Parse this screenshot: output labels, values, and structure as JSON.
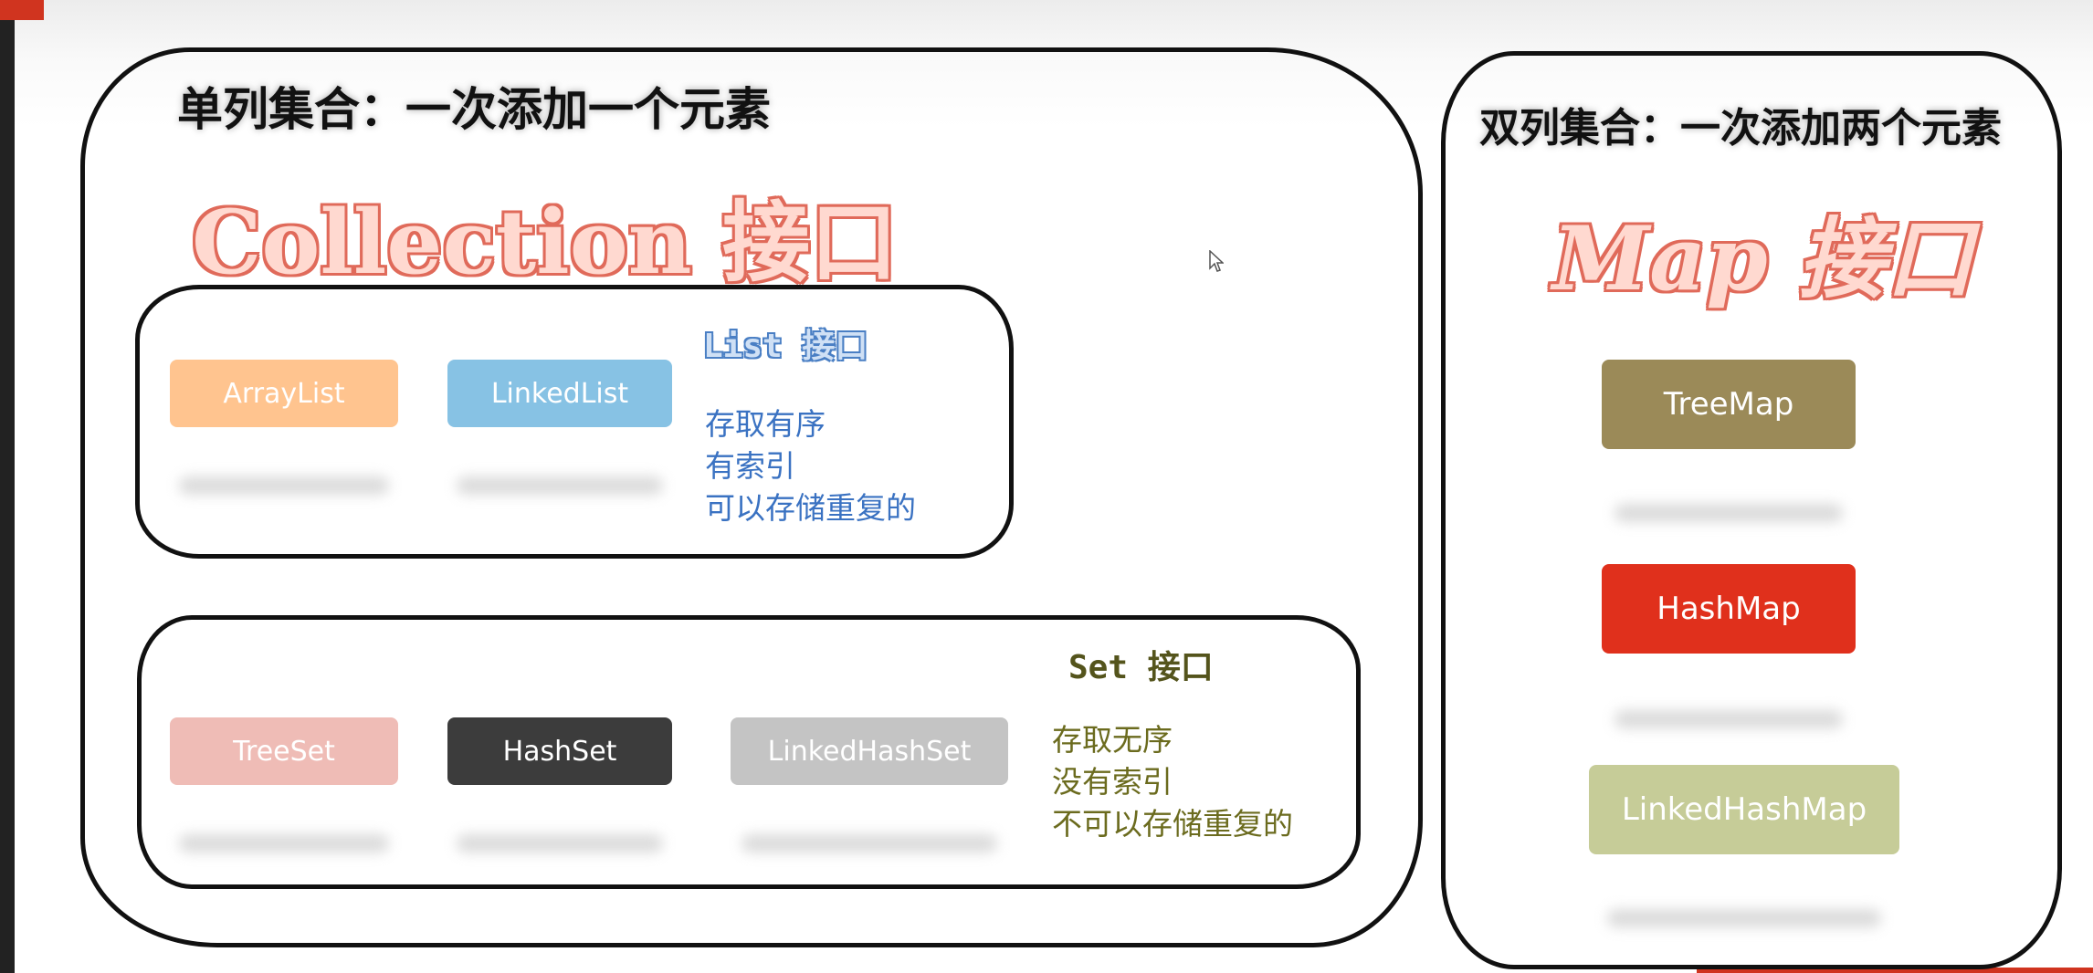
{
  "left_group": {
    "heading": "单列集合：一次添加一个元素",
    "interface_title": "Collection 接口",
    "list": {
      "label": "List 接口",
      "items": [
        "ArrayList",
        "LinkedList"
      ],
      "properties": [
        "存取有序",
        "有索引",
        "可以存储重复的"
      ]
    },
    "set": {
      "label": "Set 接口",
      "items": [
        "TreeSet",
        "HashSet",
        "LinkedHashSet"
      ],
      "properties": [
        "存取无序",
        "没有索引",
        "不可以存储重复的"
      ]
    }
  },
  "right_group": {
    "heading": "双列集合：一次添加两个元素",
    "interface_title": "Map 接口",
    "items": [
      "TreeMap",
      "HashMap",
      "LinkedHashMap"
    ]
  },
  "colors": {
    "arraylist": "#ffc48f",
    "linkedlist": "#87c2e4",
    "treeset": "#efbcb6",
    "hashset": "#3c3c3c",
    "linkedhashset": "#c4c4c4",
    "treemap": "#9b8a58",
    "hashmap": "#e0301c",
    "linkedhashmap": "#c6cc98",
    "list_text": "#3a72c2",
    "set_text": "#6b6b1e",
    "title_outline": "#e06a5a"
  },
  "icons": [
    "mouse-cursor-icon"
  ]
}
